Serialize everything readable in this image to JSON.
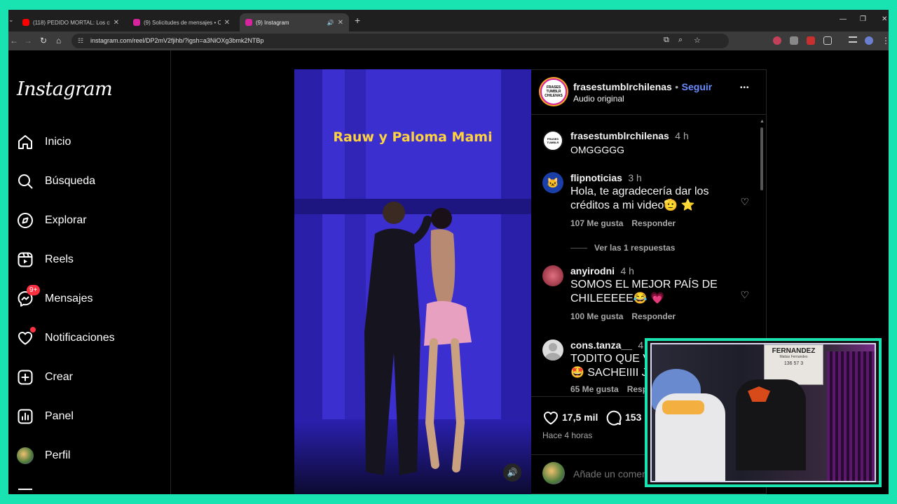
{
  "browser": {
    "tabs": [
      {
        "title": "(118) PEDIDO MORTAL: Los cha",
        "fav_color": "#ff0000"
      },
      {
        "title": "(9) Solicitudes de mensajes • Ch",
        "fav_color": "#d6249f"
      },
      {
        "title": "(9) Instagram",
        "fav_color": "#d6249f"
      }
    ],
    "new_tab": "+",
    "url": "instagram.com/reel/DP2mV2fjihb/?igsh=a3NiOXg3bmk2NTBp"
  },
  "sidebar": {
    "logo": "Instagram",
    "items": [
      {
        "label": "Inicio",
        "icon": "home-icon"
      },
      {
        "label": "Búsqueda",
        "icon": "search-icon"
      },
      {
        "label": "Explorar",
        "icon": "compass-icon"
      },
      {
        "label": "Reels",
        "icon": "reels-icon"
      },
      {
        "label": "Mensajes",
        "icon": "messenger-icon",
        "badge": "9+"
      },
      {
        "label": "Notificaciones",
        "icon": "heart-icon"
      },
      {
        "label": "Crear",
        "icon": "plus-square-icon"
      },
      {
        "label": "Panel",
        "icon": "chart-icon"
      },
      {
        "label": "Perfil",
        "icon": "avatar"
      }
    ]
  },
  "reel": {
    "caption": "Rauw y Paloma Mami"
  },
  "post": {
    "author": "frasestumblrchilenas",
    "follow_sep": "•",
    "follow": "Seguir",
    "audio": "Audio original",
    "more": "•••",
    "avatar_text": "FRASES TUMBLR CHILENAS",
    "comments": [
      {
        "user": "frasestumblrchilenas",
        "time": "4 h",
        "text": "OMGGGGG"
      },
      {
        "user": "flipnoticias",
        "time": "3 h",
        "text": "Hola, te agradecería dar los créditos a mi video🫡 ⭐",
        "likes": "107 Me gusta",
        "reply": "Responder",
        "view_replies": "Ver las 1 respuestas"
      },
      {
        "user": "anyirodni",
        "time": "4 h",
        "text": "SOMOS EL MEJOR PAÍS DE CHILEEEEE😂 💗",
        "likes": "100 Me gusta",
        "reply": "Responder"
      },
      {
        "user": "cons.tanza__",
        "time": "4 h",
        "text": "TODITO QUE V",
        "text2": "🤩 SACHEIIII JA",
        "likes": "65 Me gusta",
        "reply": "Resp"
      }
    ],
    "likes_count": "17,5 mil",
    "comments_count": "153",
    "posted": "Hace 4 horas",
    "add_comment_placeholder": "Añade un comen"
  },
  "webcam": {
    "sign": "FERNANDEZ",
    "sign_sub": "Matias Fernandes",
    "numbers": "136 57 3"
  }
}
